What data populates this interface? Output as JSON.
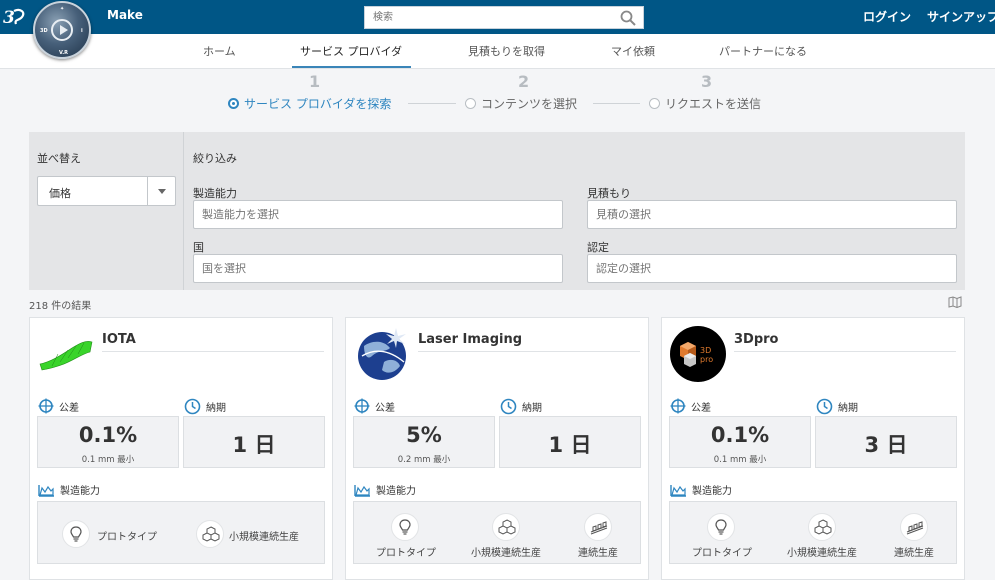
{
  "header": {
    "app_title": "Make",
    "search_placeholder": "検索",
    "login": "ログイン",
    "signup": "サインアップ"
  },
  "nav": {
    "items": [
      "ホーム",
      "サービス プロバイダ",
      "見積もりを取得",
      "マイ依頼",
      "パートナーになる"
    ],
    "active": 1
  },
  "steps": [
    {
      "num": "1",
      "label": "サービス プロバイダを探索",
      "active": true
    },
    {
      "num": "2",
      "label": "コンテンツを選択",
      "active": false
    },
    {
      "num": "3",
      "label": "リクエストを送信",
      "active": false
    }
  ],
  "filters": {
    "sort_label": "並べ替え",
    "sort_value": "価格",
    "filter_label": "絞り込み",
    "capability_label": "製造能力",
    "capability_placeholder": "製造能力を選択",
    "quote_label": "見積もり",
    "quote_placeholder": "見積の選択",
    "country_label": "国",
    "country_placeholder": "国を選択",
    "cert_label": "認定",
    "cert_placeholder": "認定の選択"
  },
  "results_count": "218 件の結果",
  "labels": {
    "tolerance": "公差",
    "lead_time": "納期",
    "capabilities": "製造能力"
  },
  "providers": [
    {
      "name": "IOTA",
      "tolerance": "0.1%",
      "tolerance_sub": "0.1 mm 最小",
      "lead_time": "1 日",
      "capabilities": [
        "プロトタイプ",
        "小規模連続生産"
      ]
    },
    {
      "name": "Laser Imaging",
      "tolerance": "5%",
      "tolerance_sub": "0.2 mm 最小",
      "lead_time": "1 日",
      "capabilities": [
        "プロトタイプ",
        "小規模連続生産",
        "連続生産"
      ]
    },
    {
      "name": "3Dpro",
      "logo_text": "3D pro",
      "tolerance": "0.1%",
      "tolerance_sub": "0.1 mm 最小",
      "lead_time": "3 日",
      "capabilities": [
        "プロトタイプ",
        "小規模連続生産",
        "連続生産"
      ]
    }
  ],
  "colors": {
    "topbar": "#005686",
    "accent": "#2f86c0",
    "iota_green": "#39d42a"
  }
}
